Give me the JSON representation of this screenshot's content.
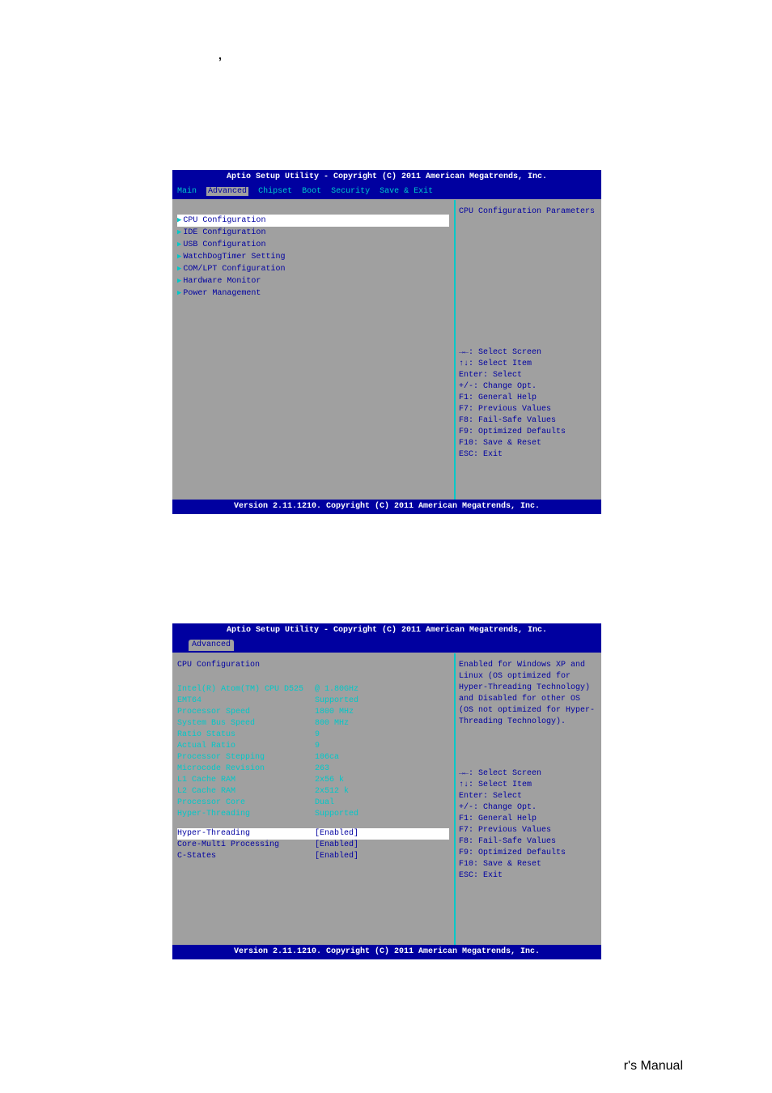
{
  "comma": ",",
  "footer": "r's Manual",
  "bios1": {
    "title": "Aptio Setup Utility - Copyright (C) 2011 American Megatrends, Inc.",
    "menu": [
      "Main",
      "Advanced",
      "Chipset",
      "Boot",
      "Security",
      "Save & Exit"
    ],
    "active_tab": "Advanced",
    "items": [
      "CPU Configuration",
      "IDE Configuration",
      "USB Configuration",
      "WatchDogTimer Setting",
      "COM/LPT Configuration",
      "Hardware Monitor",
      "Power  Management"
    ],
    "help": "CPU Configuration Parameters",
    "keys": [
      "→←: Select Screen",
      "↑↓: Select Item",
      "Enter: Select",
      "+/-: Change Opt.",
      "F1: General Help",
      "F7: Previous Values",
      "F8: Fail-Safe Values",
      "F9: Optimized Defaults",
      "F10: Save & Reset",
      "ESC: Exit"
    ],
    "status": "Version 2.11.1210. Copyright (C) 2011 American Megatrends, Inc."
  },
  "bios2": {
    "title": "Aptio Setup Utility - Copyright (C) 2011 American Megatrends, Inc.",
    "tab": "Advanced",
    "section": "CPU Configuration",
    "info": [
      {
        "label": "Intel(R) Atom(TM) CPU D525",
        "value": "@ 1.80GHz"
      },
      {
        "label": "EMT64",
        "value": "Supported"
      },
      {
        "label": "Processor Speed",
        "value": "1800 MHz"
      },
      {
        "label": "System Bus Speed",
        "value": "800 MHz"
      },
      {
        "label": "Ratio Status",
        "value": "9"
      },
      {
        "label": "Actual Ratio",
        "value": "9"
      },
      {
        "label": "Processor Stepping",
        "value": "106ca"
      },
      {
        "label": "Microcode Revision",
        "value": "263"
      },
      {
        "label": "L1 Cache RAM",
        "value": "2x56 k"
      },
      {
        "label": "L2 Cache RAM",
        "value": "2x512 k"
      },
      {
        "label": "Processor Core",
        "value": "Dual"
      },
      {
        "label": "Hyper-Threading",
        "value": "Supported"
      }
    ],
    "options": [
      {
        "label": "Hyper-Threading",
        "value": "[Enabled]"
      },
      {
        "label": "Core-Multi Processing",
        "value": "[Enabled]"
      },
      {
        "label": "C-States",
        "value": "[Enabled]"
      }
    ],
    "help": "Enabled for Windows XP and Linux (OS optimized for Hyper-Threading Technology) and Disabled for other OS (OS not optimized for Hyper-Threading Technology).",
    "keys": [
      "→←: Select Screen",
      "↑↓: Select Item",
      "Enter: Select",
      "+/-: Change Opt.",
      "F1: General Help",
      "F7: Previous Values",
      "F8: Fail-Safe Values",
      "F9: Optimized Defaults",
      "F10: Save & Reset",
      "ESC: Exit"
    ],
    "status": "Version 2.11.1210. Copyright (C) 2011 American Megatrends, Inc."
  }
}
